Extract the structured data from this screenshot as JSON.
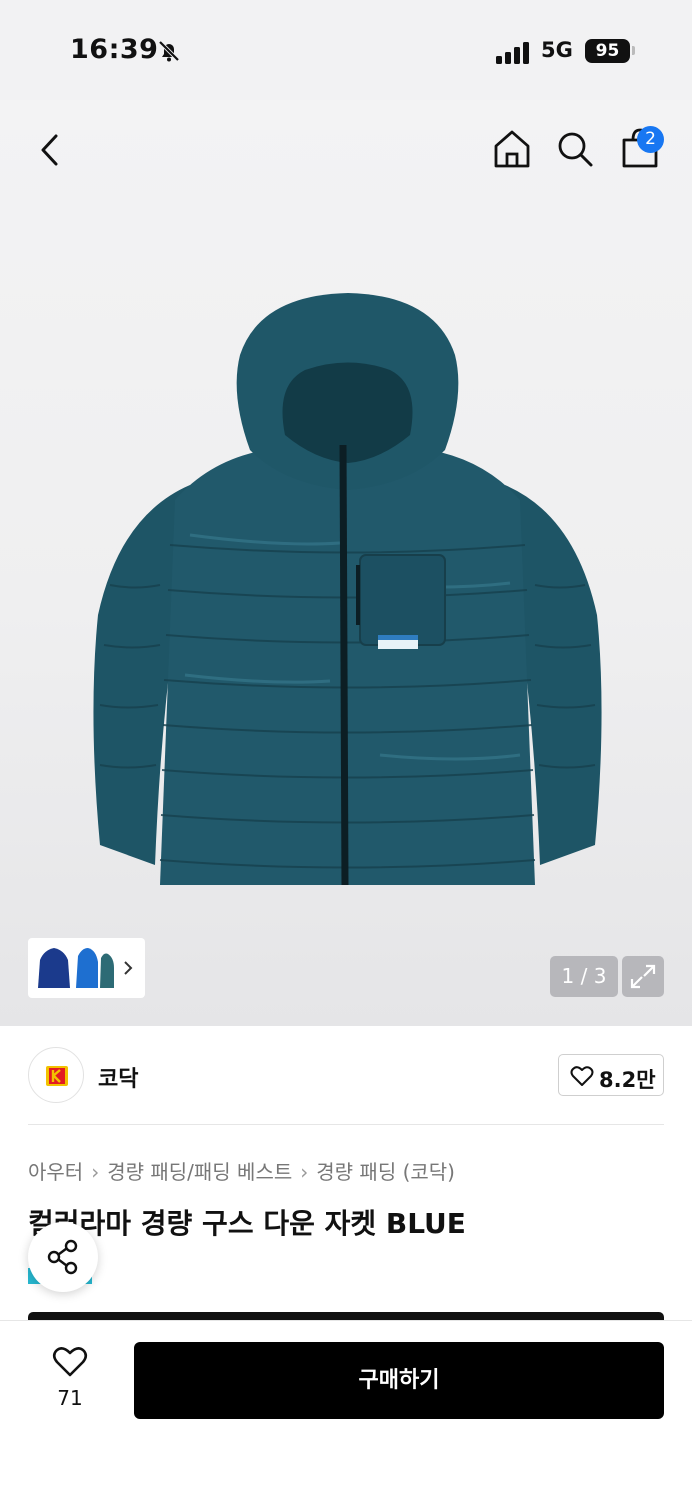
{
  "status_bar": {
    "time": "16:39",
    "network": "5G",
    "battery": "95"
  },
  "header": {
    "cart_count": "2"
  },
  "gallery": {
    "counter": "1 / 3"
  },
  "brand": {
    "name": "코닥",
    "likes": "8.2만"
  },
  "breadcrumb": [
    "아우터",
    "경량 패딩/패딩 베스트",
    "경량 패딩 (코닥)"
  ],
  "product": {
    "title": "컬러라마 경량 구스 다운 자켓 BLUE"
  },
  "bottom_bar": {
    "wish_count": "71",
    "buy_label": "구매하기"
  },
  "colors": {
    "accent": "#1877f2",
    "jacket": "#1f5566",
    "buy_button": "#000000"
  }
}
